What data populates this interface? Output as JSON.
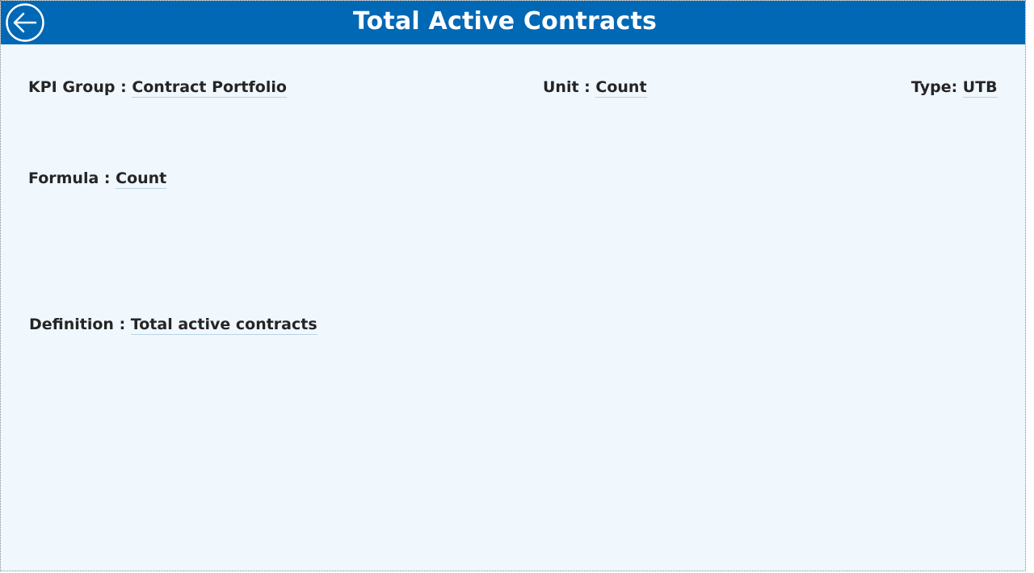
{
  "header": {
    "title": "Total Active Contracts",
    "back_icon": "arrow-left-circle-icon",
    "background_color": "#0068b5"
  },
  "fields": {
    "kpi_group": {
      "label": "KPI Group : ",
      "value": "Contract Portfolio"
    },
    "unit": {
      "label": "Unit : ",
      "value": "Count"
    },
    "type": {
      "label": "Type: ",
      "value": "UTB"
    },
    "formula": {
      "label": "Formula : ",
      "value": "Count"
    },
    "definition": {
      "label": "Definition : ",
      "value": "Total active contracts"
    }
  },
  "colors": {
    "page_background": "#f0f7fd",
    "text": "#252525"
  }
}
